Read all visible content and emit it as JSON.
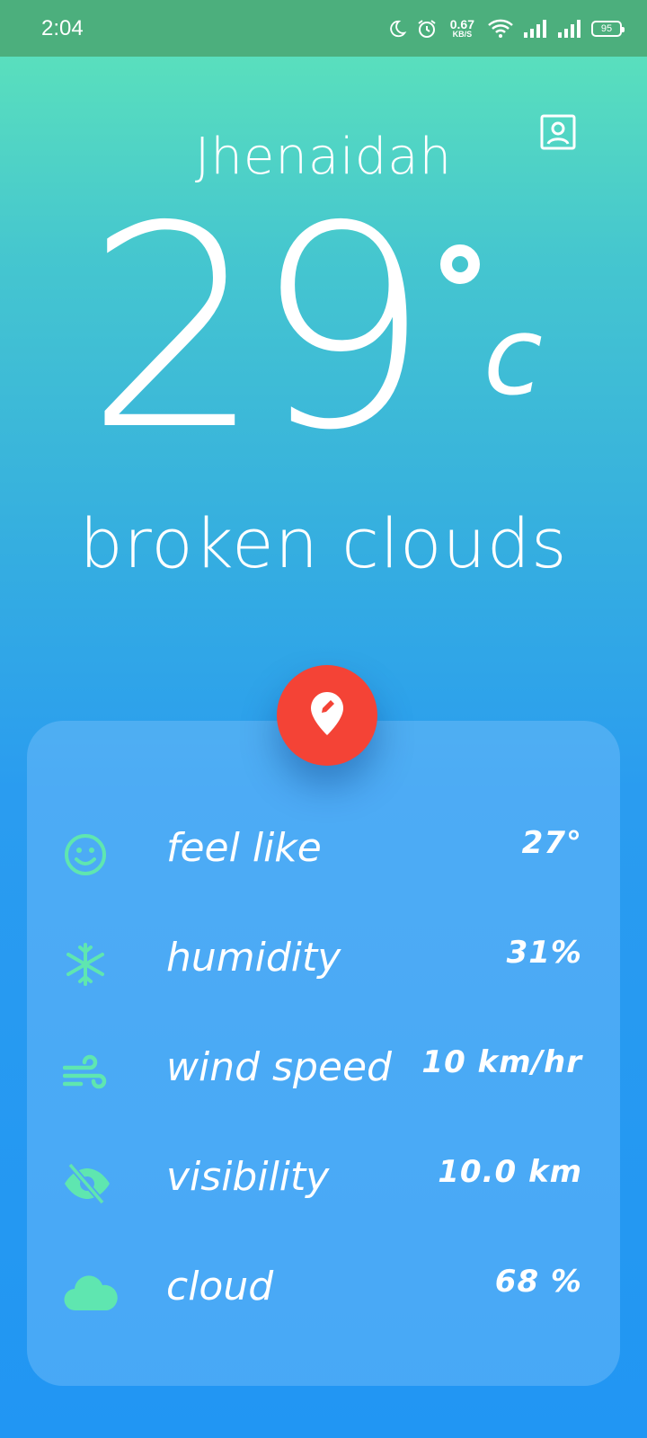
{
  "status_bar": {
    "time": "2:04",
    "net_speed_value": "0.67",
    "net_speed_unit": "KB/S",
    "battery": "95",
    "icons": [
      "moon-icon",
      "alarm-icon",
      "wifi-icon",
      "signal-icon",
      "signal-icon-2",
      "battery-icon"
    ]
  },
  "weather": {
    "city": "Jhenaidah",
    "temperature": "29",
    "unit": "c",
    "description": "broken clouds"
  },
  "details": [
    {
      "icon": "smile-icon",
      "label": "feel like",
      "value": "27°"
    },
    {
      "icon": "snowflake-icon",
      "label": "humidity",
      "value": "31%"
    },
    {
      "icon": "wind-icon",
      "label": "wind speed",
      "value": "10 km/hr"
    },
    {
      "icon": "eye-off-icon",
      "label": "visibility",
      "value": "10.0 km"
    },
    {
      "icon": "cloud-icon",
      "label": "cloud",
      "value": "68 %"
    }
  ],
  "colors": {
    "accent": "#5fe6b0",
    "fab": "#f44336",
    "status_bar": "#4caf7d"
  }
}
